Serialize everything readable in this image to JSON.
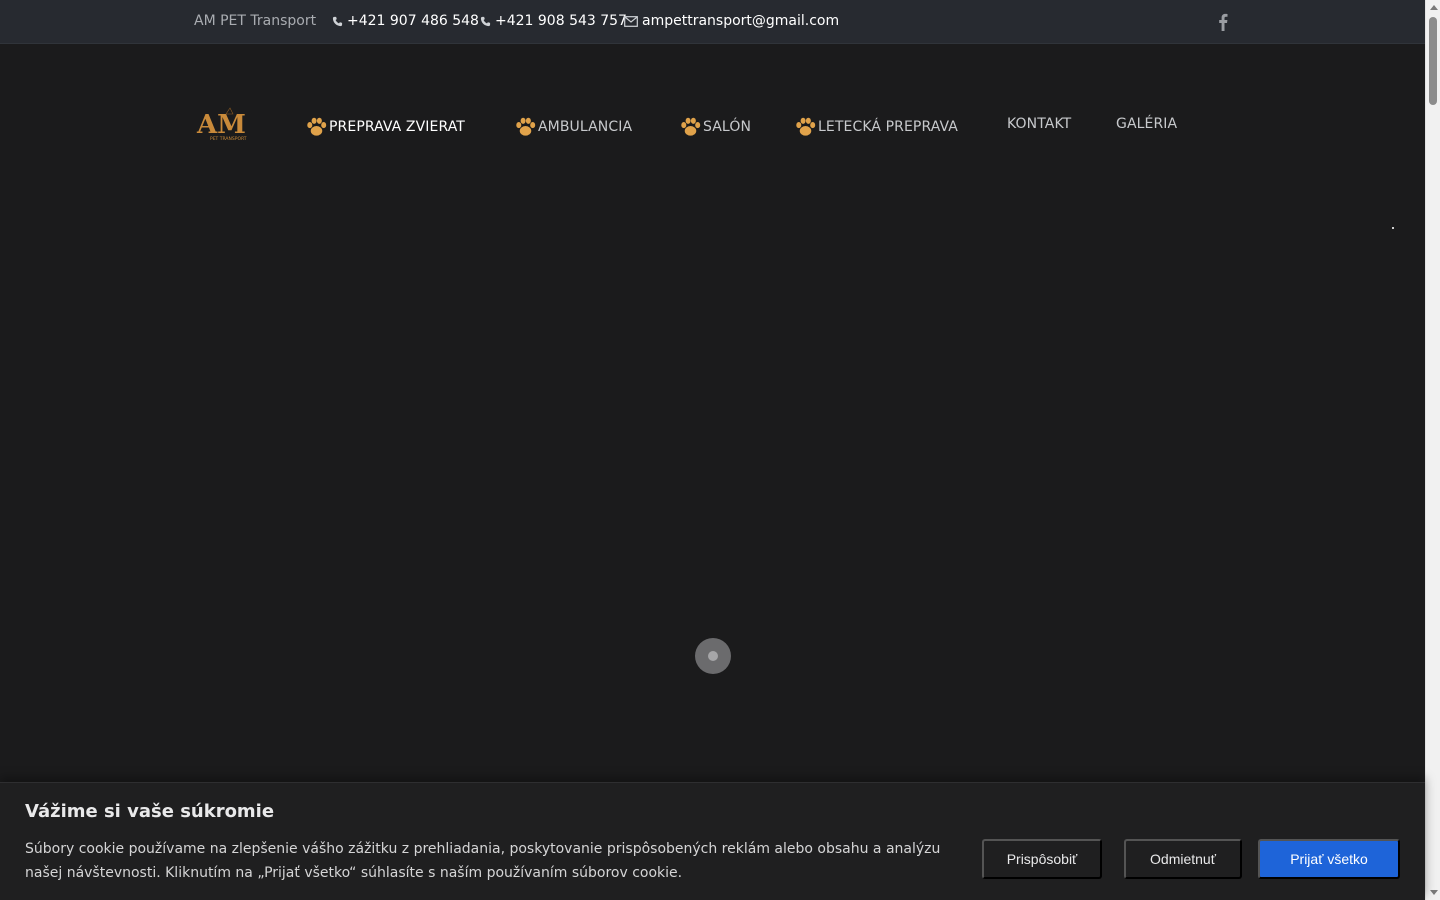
{
  "topbar": {
    "brand": "AM PET Transport",
    "phone1": "+421 907 486 548",
    "phone2": "+421 908 543 757",
    "email": "ampettransport@gmail.com",
    "phone_icon": "phone-icon",
    "email_icon": "envelope-icon",
    "social_icon": "facebook-icon"
  },
  "logo": {
    "text": "AM",
    "subtext": "PET TRANSPORT"
  },
  "nav": {
    "items": [
      {
        "label": "PREPRAVA ZVIERAT",
        "icon": "paw-icon",
        "active": true
      },
      {
        "label": "AMBULANCIA",
        "icon": "paw-icon"
      },
      {
        "label": "SALÓN",
        "icon": "paw-icon"
      },
      {
        "label": "LETECKÁ PREPRAVA",
        "icon": "paw-icon"
      },
      {
        "label": "KONTAKT"
      },
      {
        "label": "GALÉRIA"
      }
    ]
  },
  "cookie": {
    "title": "Vážime si vaše súkromie",
    "text": "Súbory cookie používame na zlepšenie vášho zážitku z prehliadania, poskytovanie prispôsobených reklám alebo obsahu a analýzu našej návštevnosti. Kliknutím na „Prijať všetko“ súhlasíte s naším používaním súborov cookie.",
    "customize": "Prispôsobiť",
    "reject": "Odmietnuť",
    "accept": "Prijať všetko"
  },
  "colors": {
    "accent": "#1e64d9",
    "paw": "#e0a24a",
    "background": "#1b1b1c"
  }
}
